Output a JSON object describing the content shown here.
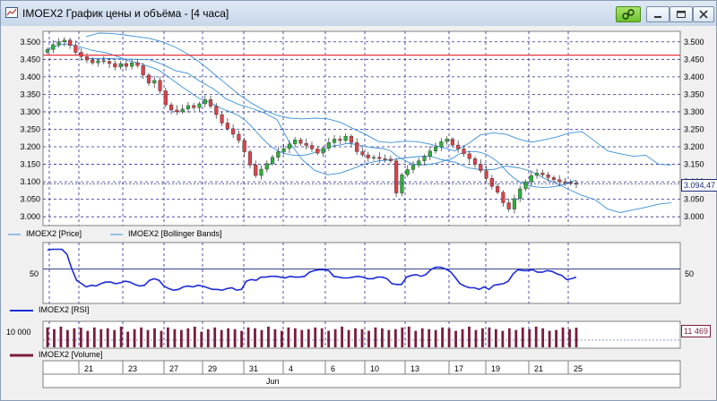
{
  "window": {
    "title": "IMOEX2 График цены и объёма - [4 часа]"
  },
  "price_pane": {
    "y_ticks": [
      "3.500",
      "3.450",
      "3.400",
      "3.350",
      "3.300",
      "3.250",
      "3.200",
      "3.150",
      "3.100",
      "3.050",
      "3.000"
    ],
    "last_price_label": "3.094,47",
    "legend": [
      "IMOEX2 [Price]",
      "IMOEX2 [Bollinger Bands]"
    ]
  },
  "rsi_pane": {
    "y_tick": "50",
    "legend": "IMOEX2 [RSI]"
  },
  "volume_pane": {
    "y_tick": "10 000",
    "last_volume_label": "11 469",
    "legend": "IMOEX2 [Volume]"
  },
  "date_axis": {
    "days": [
      "21",
      "23",
      "27",
      "29",
      "31",
      "4",
      "6",
      "10",
      "13",
      "17",
      "19",
      "21",
      "25"
    ],
    "month": "Jun"
  },
  "colors": {
    "up_candle": "#2fae3a",
    "down_candle": "#d9434b",
    "bollinger": "#3a8fd6",
    "rsi": "#1c2bd6",
    "volume": "#7a1c3c",
    "resistance": "#e8333d",
    "grid": "#2a2a9a"
  },
  "chart_data": [
    {
      "type": "line",
      "name": "Price",
      "series": [
        {
          "name": "IMOEX2 [Price]",
          "values": [
            3478,
            3492,
            3500,
            3505,
            3490,
            3470,
            3458,
            3448,
            3440,
            3446,
            3444,
            3438,
            3428,
            3438,
            3430,
            3440,
            3432,
            3405,
            3382,
            3390,
            3360,
            3320,
            3305,
            3300,
            3308,
            3318,
            3312,
            3323,
            3335,
            3316,
            3292,
            3268,
            3252,
            3236,
            3218,
            3186,
            3148,
            3118,
            3136,
            3152,
            3170,
            3186,
            3195,
            3208,
            3220,
            3210,
            3204,
            3194,
            3182,
            3196,
            3212,
            3222,
            3218,
            3230,
            3212,
            3186,
            3177,
            3168,
            3170,
            3166,
            3165,
            3160,
            3068,
            3120,
            3135,
            3148,
            3160,
            3172,
            3188,
            3200,
            3215,
            3222,
            3205,
            3194,
            3180,
            3166,
            3150,
            3132,
            3110,
            3087,
            3070,
            3040,
            3022,
            3052,
            3080,
            3100,
            3118,
            3125,
            3120,
            3112,
            3106,
            3100,
            3098,
            3096,
            3094
          ]
        },
        {
          "name": "IMOEX2 [Bollinger Bands] upper",
          "values": [
            3515,
            3525,
            3524,
            3520,
            3515,
            3510,
            3500,
            3485,
            3465,
            3440,
            3410,
            3380,
            3350,
            3325,
            3305,
            3290,
            3282,
            3280,
            3282,
            3280,
            3270,
            3252,
            3235,
            3215,
            3212,
            3216,
            3215,
            3208,
            3198,
            3188,
            3208,
            3234,
            3240,
            3236,
            3222,
            3213,
            3220,
            3228,
            3240,
            3243,
            3216,
            3188,
            3180,
            3173,
            3176,
            3150,
            3148
          ]
        },
        {
          "name": "IMOEX2 [Bollinger Bands] lower",
          "values": [
            3452,
            3452,
            3452,
            3451,
            3450,
            3449,
            3436,
            3418,
            3410,
            3386,
            3366,
            3337,
            3321,
            3310,
            3297,
            3278,
            3212,
            3163,
            3132,
            3120,
            3125,
            3138,
            3152,
            3160,
            3163,
            3168,
            3172,
            3174,
            3163,
            3156,
            3140,
            3135,
            3135,
            3145,
            3140,
            3130,
            3110,
            3095,
            3077,
            3061,
            3049,
            3022,
            3012,
            3020,
            3027,
            3036,
            3040
          ]
        }
      ],
      "hlines": [
        {
          "name": "resistance",
          "y": 3462
        },
        {
          "name": "last",
          "y": 3094.47
        }
      ],
      "y_ticks": [
        3500,
        3450,
        3400,
        3350,
        3300,
        3250,
        3200,
        3150,
        3100,
        3050,
        3000
      ],
      "ylim": [
        2980,
        3525
      ]
    },
    {
      "type": "line",
      "name": "RSI",
      "series": [
        {
          "name": "IMOEX2 [RSI]",
          "values": [
            73,
            74,
            74,
            74,
            68,
            50,
            36,
            32,
            28,
            30,
            29,
            32,
            34,
            34,
            32,
            33,
            35,
            34,
            31,
            29,
            30,
            36,
            38,
            36,
            29,
            26,
            24,
            25,
            28,
            29,
            28,
            30,
            29,
            27,
            25,
            25,
            24,
            26,
            27,
            24,
            25,
            35,
            37,
            36,
            40,
            40,
            41,
            41,
            40,
            39,
            41,
            40,
            40,
            41,
            46,
            48,
            49,
            49,
            48,
            41,
            40,
            39,
            39,
            40,
            41,
            40,
            38,
            38,
            40,
            40,
            38,
            32,
            31,
            31,
            40,
            42,
            43,
            41,
            43,
            49,
            52,
            52,
            50,
            47,
            40,
            32,
            29,
            27,
            27,
            25,
            28,
            25,
            30,
            31,
            32,
            35,
            44,
            49,
            48,
            48,
            49,
            46,
            46,
            48,
            47,
            44,
            42,
            37,
            38,
            40
          ]
        }
      ],
      "y_ticks": [
        50
      ],
      "ylim": [
        10,
        80
      ]
    },
    {
      "type": "bar",
      "name": "Volume",
      "series": [
        {
          "name": "IMOEX2 [Volume]",
          "values": [
            11500,
            11300,
            11600,
            11200,
            11400,
            11469,
            11100,
            11500,
            11300,
            11400,
            11200,
            11600,
            11000,
            11300,
            11500,
            11200,
            11400,
            11100,
            11500,
            11300,
            11200,
            11400,
            11600,
            11000,
            11300,
            11500,
            11200,
            11400,
            11300,
            11100,
            11500,
            11400,
            11200,
            11600,
            11300,
            11100,
            11500,
            11400,
            11200,
            11300,
            11500,
            11400,
            11100,
            11300,
            11600,
            11200,
            11400,
            11300,
            11100,
            11500,
            11400,
            11200,
            11300,
            11500,
            11600,
            11100,
            11400,
            11300,
            11200,
            11500,
            11400,
            11100,
            11300,
            11600,
            11200,
            11400,
            11500,
            11300,
            11100,
            11400,
            11200,
            11500,
            11300,
            11600,
            11400,
            11100,
            11200,
            11500,
            11300,
            11469
          ]
        }
      ],
      "y_ticks": [
        10000
      ]
    }
  ]
}
